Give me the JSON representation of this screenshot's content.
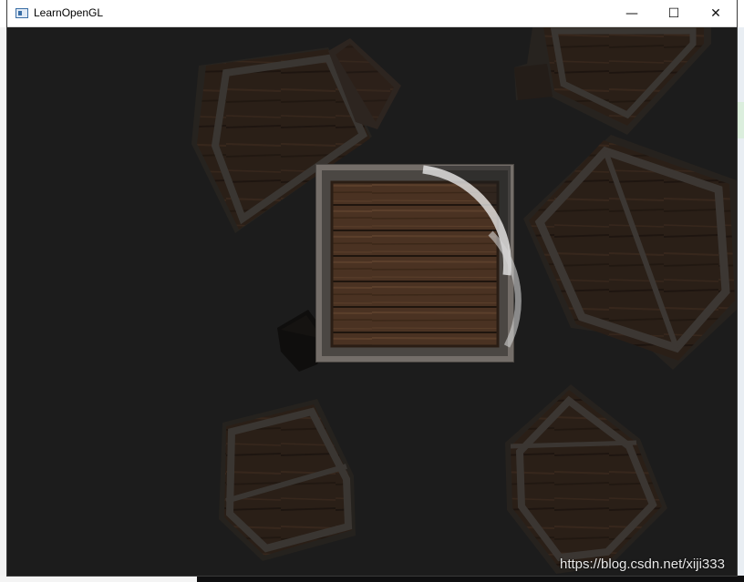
{
  "window": {
    "title": "LearnOpenGL",
    "controls": {
      "minimize": "—",
      "maximize": "☐",
      "close": "✕"
    }
  },
  "scene": {
    "background_color": "#1c1c1c",
    "object": "wooden crate",
    "crate_count": 10,
    "lighting": "spotlight"
  },
  "watermark": "https://blog.csdn.net/xiji333"
}
